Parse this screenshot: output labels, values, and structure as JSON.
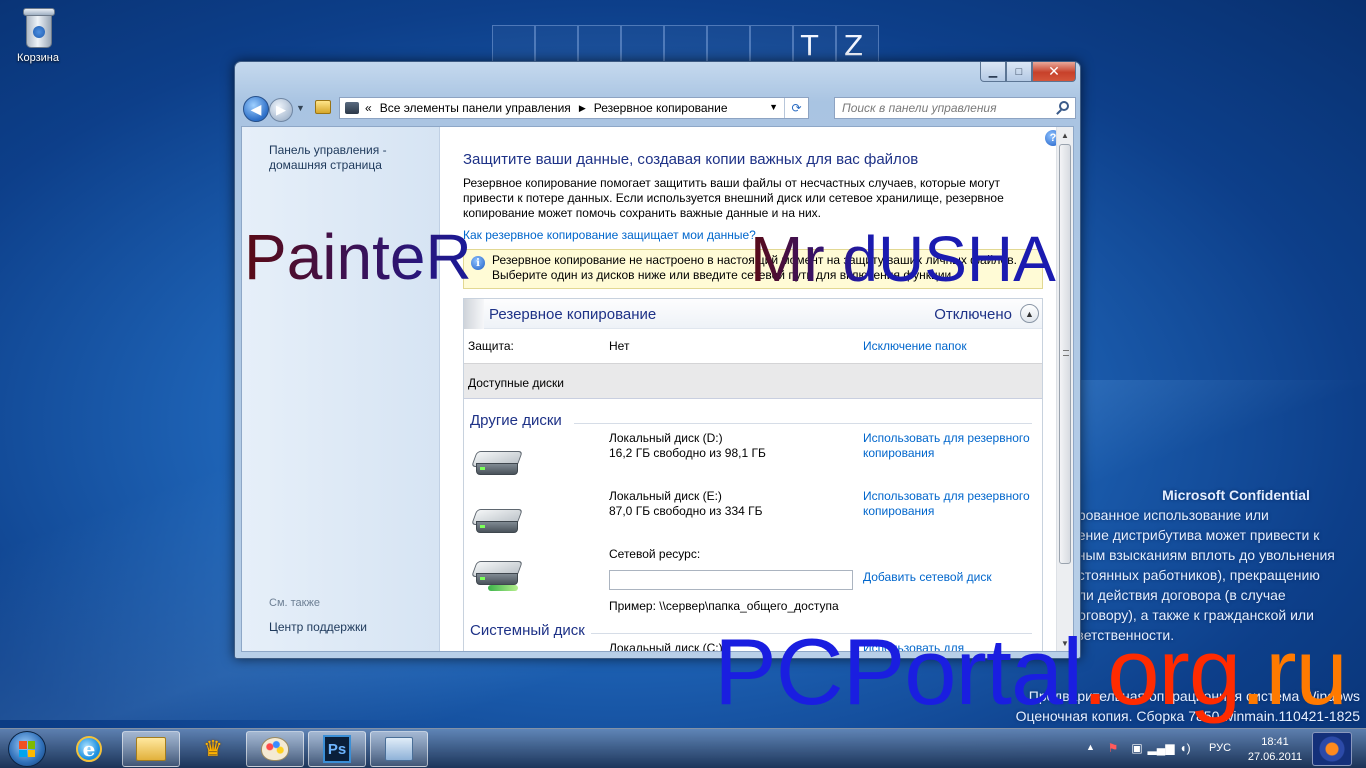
{
  "desktop": {
    "recycle_bin_label": "Корзина",
    "wall_letters": [
      "T",
      "Z"
    ],
    "confidential": {
      "heading": "Microsoft Confidential",
      "lines": [
        "ированное использование или",
        "нение дистрибутива может привести к",
        "рным взысканиям вплоть до увольнения",
        "остоянных работников), прекращению",
        "или действия договора (в случае",
        "договору), а также к гражданской или",
        "тветственности."
      ]
    },
    "build_line1": "Предварительная операционная система Windows",
    "build_line2": "Оценочная копия. Сборка 7850.winmain.110421-1825"
  },
  "watermarks": {
    "left": "PainteR",
    "right": "Mr dUSHA",
    "site_part1": "PCPortal",
    "site_part2": ".org",
    "site_part3": ".ru"
  },
  "window": {
    "caption_buttons": {
      "minimize": "▁",
      "maximize": "□",
      "close": "✕"
    },
    "nav": {
      "back": "◀",
      "forward": "▶",
      "dropdown": "▼"
    },
    "address": {
      "chevron": "«",
      "crumb1": "Все элементы панели управления",
      "separator": "▶",
      "crumb2": "Резервное копирование",
      "dropdown": "▼",
      "refresh": "⟳"
    },
    "search_placeholder": "Поиск в панели управления",
    "left_pane": {
      "home_link": "Панель управления - домашняя страница",
      "see_also": "См. также",
      "support_center": "Центр поддержки"
    },
    "main": {
      "help": "?",
      "title": "Защитите ваши данные, создавая копии важных для вас файлов",
      "intro": "Резервное копирование помогает защитить ваши файлы от несчастных случаев, которые могут привести к потере данных. Если используется внешний диск или сетевое хранилище, резервное копирование может помочь сохранить важные данные и на них.",
      "how_link": "Как резервное копирование защищает мои данные?",
      "info_line1": "Резервное копирование не настроено в настоящий момент на защиту ваших личных файлов.",
      "info_line2": "Выберите один из дисков ниже или введите сетевой путь для включения функции.",
      "info_icon": "i",
      "panel": {
        "title": "Резервное копирование",
        "state": "Отключено",
        "collapse": "▲",
        "protection_label": "Защита:",
        "protection_value": "Нет",
        "exclude_link": "Исключение папок",
        "available_disks": "Доступные диски",
        "other_disks_title": "Другие диски",
        "disks": [
          {
            "name": "Локальный диск (D:)",
            "space": "16,2 ГБ свободно из 98,1 ГБ",
            "link": "Использовать для резервного копирования"
          },
          {
            "name": "Локальный диск (E:)",
            "space": "87,0 ГБ свободно из 334 ГБ",
            "link": "Использовать для резервного копирования"
          }
        ],
        "network_label": "Сетевой ресурс:",
        "network_add_link": "Добавить сетевой диск",
        "network_example": "Пример: \\\\сервер\\папка_общего_доступа",
        "system_disk_title": "Системный диск",
        "system_disk_name": "Локальный диск (C:)",
        "system_disk_link": "Использовать для"
      }
    },
    "scrollbar": {
      "up": "▲",
      "down": "▼"
    }
  },
  "taskbar": {
    "apps": [
      "internet-explorer",
      "windows-explorer",
      "crown-app",
      "paint",
      "photoshop",
      "control-panel"
    ],
    "photoshop_label": "Ps",
    "ie_label": "e",
    "tray": {
      "show_hidden": "▲",
      "language": "РУС",
      "time": "18:41",
      "date": "27.06.2011"
    }
  }
}
